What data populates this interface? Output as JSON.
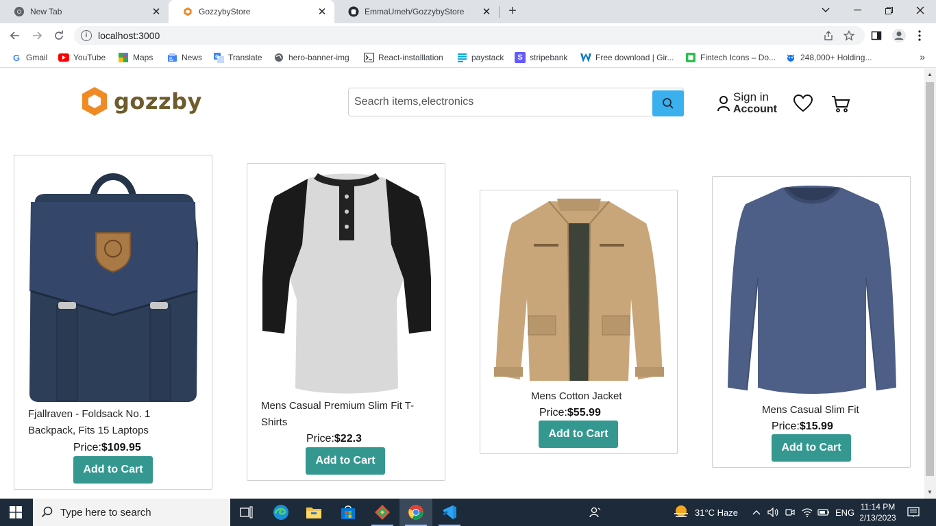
{
  "browser": {
    "tabs": [
      {
        "title": "New Tab",
        "icon": "chrome-icon",
        "active": false
      },
      {
        "title": "GozzybyStore",
        "icon": "gozzby-favicon",
        "active": true
      },
      {
        "title": "EmmaUmeh/GozzybyStore",
        "icon": "github-icon",
        "active": false
      }
    ],
    "url": "localhost:3000",
    "bookmarks": [
      {
        "label": "Gmail",
        "icon": "google-icon"
      },
      {
        "label": "YouTube",
        "icon": "youtube-icon"
      },
      {
        "label": "Maps",
        "icon": "maps-icon"
      },
      {
        "label": "News",
        "icon": "news-icon"
      },
      {
        "label": "Translate",
        "icon": "translate-icon"
      },
      {
        "label": "hero-banner-img",
        "icon": "globe-icon"
      },
      {
        "label": "React-installlation",
        "icon": "terminal-icon"
      },
      {
        "label": "paystack",
        "icon": "paystack-icon"
      },
      {
        "label": "stripebank",
        "icon": "stripe-icon"
      },
      {
        "label": "Free download | Gir...",
        "icon": "w-icon"
      },
      {
        "label": "Fintech Icons – Do...",
        "icon": "green-square-icon"
      },
      {
        "label": "248,000+ Holding...",
        "icon": "bug-icon"
      }
    ]
  },
  "site": {
    "logo_text": "gozzby",
    "search_placeholder": "Seacrh items,electronics",
    "signin_line1": "Sign in",
    "signin_line2": "Account",
    "accent_color": "#349891",
    "search_button_color": "#3ab0ef"
  },
  "products": [
    {
      "name": "Fjallraven - Foldsack No. 1 Backpack, Fits 15 Laptops",
      "price_label": "Price:",
      "price": "$109.95",
      "button": "Add to Cart"
    },
    {
      "name": "Mens Casual Premium Slim Fit T-Shirts",
      "price_label": "Price:",
      "price": "$22.3",
      "button": "Add to Cart"
    },
    {
      "name": "Mens Cotton Jacket",
      "price_label": "Price:",
      "price": "$55.99",
      "button": "Add to Cart"
    },
    {
      "name": "Mens Casual Slim Fit",
      "price_label": "Price:",
      "price": "$15.99",
      "button": "Add to Cart"
    }
  ],
  "taskbar": {
    "search_placeholder": "Type here to search",
    "weather": "31°C  Haze",
    "language": "ENG",
    "time": "11:14 PM",
    "date": "2/13/2023"
  }
}
